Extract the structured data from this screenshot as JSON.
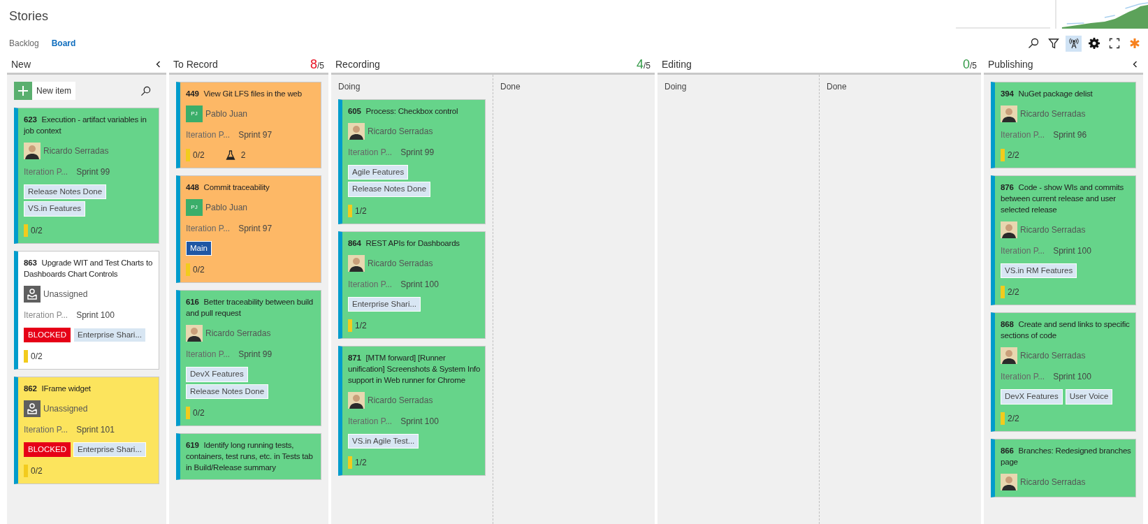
{
  "title": "Stories",
  "tabs": [
    {
      "label": "Backlog",
      "selected": false
    },
    {
      "label": "Board",
      "selected": true
    }
  ],
  "toolbar_buttons": [
    {
      "selected": false
    },
    {
      "selected": false
    },
    {
      "selected": true
    },
    {
      "selected": false
    },
    {
      "selected": false
    },
    {
      "selected": false
    }
  ],
  "columns": [
    {
      "title": "New",
      "collapsible": true,
      "new_item": "New item",
      "cards": [
        {
          "id": "623",
          "title": "Execution - artifact variables in job context",
          "color": "#66d48a",
          "assignee": {
            "kind": "photo",
            "name": "Ricardo Serradas"
          },
          "field_label": "Iteration P...",
          "field_value": "Sprint 99",
          "tags": [
            {
              "kind": "tag",
              "text": "Release Notes Done"
            },
            {
              "kind": "tag",
              "text": "VS.in Features"
            }
          ],
          "tasks": "0/2"
        },
        {
          "id": "863",
          "title": "Upgrade WIT and Test Charts to Dashboards Chart Controls",
          "color": "#ffffff",
          "assignee": {
            "kind": "unassigned",
            "name": "Unassigned"
          },
          "field_label": "Iteration P...",
          "field_value": "Sprint 100",
          "tags": [
            {
              "kind": "blocked",
              "text": "BLOCKED"
            },
            {
              "kind": "tag",
              "text": "Enterprise Shari..."
            }
          ],
          "tasks": "0/2"
        },
        {
          "id": "862",
          "title": "IFrame widget",
          "color": "#fce45d",
          "assignee": {
            "kind": "unassigned",
            "name": "Unassigned"
          },
          "field_label": "Iteration P...",
          "field_value": "Sprint 101",
          "tags": [
            {
              "kind": "blocked",
              "text": "BLOCKED"
            },
            {
              "kind": "tag",
              "text": "Enterprise Shari..."
            }
          ],
          "tasks": "0/2"
        }
      ]
    },
    {
      "title": "To Record",
      "count": "8",
      "limit": "/5",
      "over_limit": true,
      "cards": [
        {
          "id": "449",
          "title": "View Git LFS files in the web",
          "color": "#fdb866",
          "assignee": {
            "kind": "initials",
            "initials": "PJ",
            "name": "Pablo Juan"
          },
          "field_label": "Iteration P...",
          "field_value": "Sprint 97",
          "tasks": "0/2",
          "tests": "2"
        },
        {
          "id": "448",
          "title": "Commit traceability",
          "color": "#fdb866",
          "assignee": {
            "kind": "initials",
            "initials": "PJ",
            "name": "Pablo Juan"
          },
          "field_label": "Iteration P...",
          "field_value": "Sprint 97",
          "tags": [
            {
              "kind": "main",
              "text": "Main"
            }
          ],
          "tasks": "0/2"
        },
        {
          "id": "616",
          "title": "Better traceability between build and pull request",
          "color": "#66d48a",
          "assignee": {
            "kind": "photo",
            "name": "Ricardo Serradas"
          },
          "field_label": "Iteration P...",
          "field_value": "Sprint 99",
          "tags": [
            {
              "kind": "tag",
              "text": "DevX Features"
            },
            {
              "kind": "tag",
              "text": "Release Notes Done"
            }
          ],
          "tasks": "0/2"
        },
        {
          "id": "619",
          "title": "Identify long running tests, containers, test runs, etc. in Tests tab in Build/Release summary",
          "color": "#66d48a"
        }
      ]
    },
    {
      "title": "Recording",
      "count": "4",
      "limit": "/5",
      "over_limit": false,
      "subcolumns": [
        {
          "title": "Doing",
          "cards": [
            {
              "id": "605",
              "title": "Process: Checkbox control",
              "color": "#66d48a",
              "assignee": {
                "kind": "photo",
                "name": "Ricardo Serradas"
              },
              "field_label": "Iteration P...",
              "field_value": "Sprint 99",
              "tags": [
                {
                  "kind": "tag",
                  "text": "Agile Features"
                },
                {
                  "kind": "tag",
                  "text": "Release Notes Done"
                }
              ],
              "tasks": "1/2"
            },
            {
              "id": "864",
              "title": "REST APIs for Dashboards",
              "color": "#66d48a",
              "assignee": {
                "kind": "photo",
                "name": "Ricardo Serradas"
              },
              "field_label": "Iteration P...",
              "field_value": "Sprint 100",
              "tags": [
                {
                  "kind": "tag",
                  "text": "Enterprise Shari..."
                }
              ],
              "tasks": "1/2"
            },
            {
              "id": "871",
              "title": "[MTM forward] [Runner unification] Screenshots & System Info support in Web runner for Chrome",
              "color": "#66d48a",
              "assignee": {
                "kind": "photo",
                "name": "Ricardo Serradas"
              },
              "field_label": "Iteration P...",
              "field_value": "Sprint 100",
              "tags": [
                {
                  "kind": "tag",
                  "text": "VS.in Agile Test..."
                }
              ],
              "tasks": "1/2"
            }
          ]
        },
        {
          "title": "Done"
        }
      ]
    },
    {
      "title": "Editing",
      "count": "0",
      "limit": "/5",
      "over_limit": false,
      "subcolumns": [
        {
          "title": "Doing"
        },
        {
          "title": "Done"
        }
      ]
    },
    {
      "title": "Publishing",
      "collapsible": true,
      "cards": [
        {
          "id": "394",
          "title": "NuGet package delist",
          "color": "#66d48a",
          "assignee": {
            "kind": "photo",
            "name": "Ricardo Serradas"
          },
          "field_label": "Iteration P...",
          "field_value": "Sprint 96",
          "tasks": "2/2"
        },
        {
          "id": "876",
          "title": "Code - show WIs and commits between current release and user selected release",
          "color": "#66d48a",
          "assignee": {
            "kind": "photo",
            "name": "Ricardo Serradas"
          },
          "field_label": "Iteration P...",
          "field_value": "Sprint 100",
          "tags": [
            {
              "kind": "tag",
              "text": "VS.in RM Features"
            }
          ],
          "tasks": "2/2"
        },
        {
          "id": "868",
          "title": "Create and send links to specific sections of code",
          "color": "#66d48a",
          "assignee": {
            "kind": "photo",
            "name": "Ricardo Serradas"
          },
          "field_label": "Iteration P...",
          "field_value": "Sprint 100",
          "tags": [
            {
              "kind": "tag",
              "text": "DevX Features"
            },
            {
              "kind": "tag",
              "text": "User Voice"
            }
          ],
          "tasks": "2/2"
        },
        {
          "id": "866",
          "title": "Branches: Redesigned branches page",
          "color": "#66d48a",
          "assignee": {
            "kind": "photo",
            "name": "Ricardo Serradas"
          }
        }
      ]
    }
  ]
}
